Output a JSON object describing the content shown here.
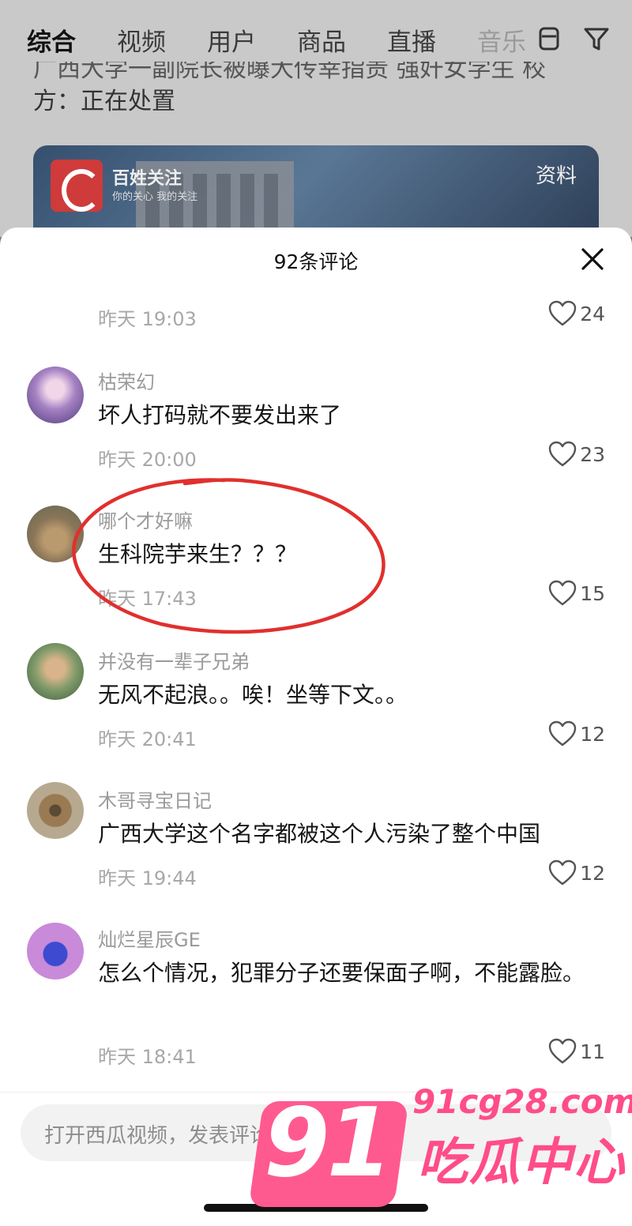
{
  "background": {
    "tabs": [
      "综合",
      "视频",
      "用户",
      "商品",
      "直播",
      "音乐"
    ],
    "headline_line1": "广西大学一副院长被曝大传幸指责 强奸女学生 校",
    "headline_line2": "方：正在处置",
    "card": {
      "logo_name": "百姓关注",
      "logo_slogan": "你的关心 我的关注",
      "tag": "资料"
    }
  },
  "sheet": {
    "title": "92条评论",
    "comments": [
      {
        "user": "",
        "text": "",
        "time": "昨天 19:03",
        "likes": "24"
      },
      {
        "user": "枯荣幻",
        "text": "坏人打码就不要发出来了",
        "time": "昨天 20:00",
        "likes": "23"
      },
      {
        "user": "哪个才好嘛",
        "text": "生科院芋来生？？？",
        "time": "昨天 17:43",
        "likes": "15"
      },
      {
        "user": "并没有一辈子兄弟",
        "text": "无风不起浪。。唉！坐等下文。。",
        "time": "昨天 20:41",
        "likes": "12"
      },
      {
        "user": "木哥寻宝日记",
        "text": "广西大学这个名字都被这个人污染了整个中国",
        "time": "昨天 19:44",
        "likes": "12"
      },
      {
        "user": "灿烂星辰GE",
        "text": "怎么个情况，犯罪分子还要保面子啊，不能露脸。",
        "time": "昨天 18:41",
        "likes": "11"
      }
    ],
    "input_placeholder": "打开西瓜视频，发表评论"
  },
  "watermark": {
    "number": "91",
    "url": "91cg28.com",
    "text": "吃瓜中心"
  },
  "colors": {
    "annotation": "#e0302e",
    "watermark": "#ff4d88"
  }
}
